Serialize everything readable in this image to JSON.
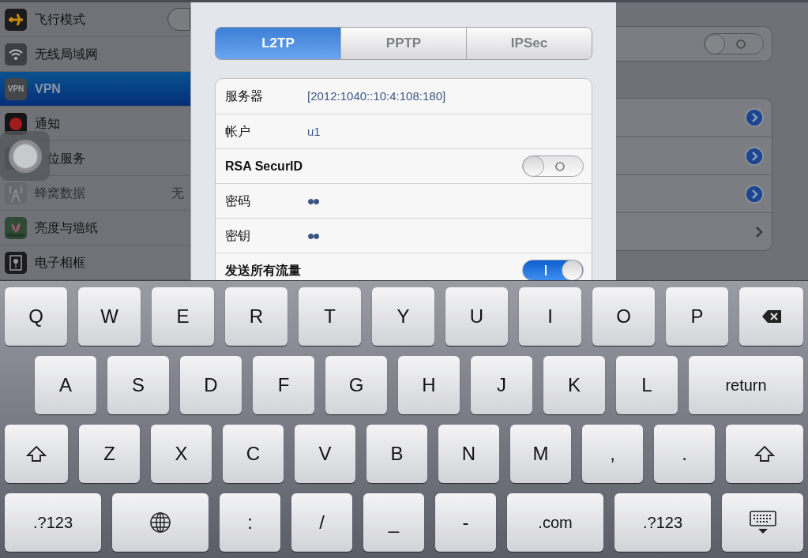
{
  "settings_list": [
    {
      "kind": "airplane",
      "label": "飞行模式",
      "selected": false,
      "disabled": false,
      "toggle_on": false
    },
    {
      "kind": "wifi",
      "label": "无线局域网",
      "selected": false,
      "disabled": false
    },
    {
      "kind": "vpn",
      "icon_text": "VPN",
      "label": "VPN",
      "selected": true,
      "disabled": false
    },
    {
      "kind": "notifications",
      "label": "通知",
      "selected": false,
      "disabled": false
    },
    {
      "kind": "location",
      "label": "位服务",
      "selected": false,
      "disabled": false
    },
    {
      "kind": "cellular",
      "label": "蜂窝数据",
      "value": "无",
      "selected": false,
      "disabled": true
    },
    {
      "kind": "wallpaper",
      "label": "亮度与墙纸",
      "selected": false,
      "disabled": false
    },
    {
      "kind": "frame",
      "label": "电子相框",
      "selected": false,
      "disabled": false
    }
  ],
  "background_panel": {
    "toggle_on": false,
    "rows": [
      {
        "kind": "detail"
      },
      {
        "kind": "detail"
      },
      {
        "kind": "detail"
      },
      {
        "kind": "chevron"
      }
    ]
  },
  "vpn_config": {
    "tabs": [
      {
        "label": "L2TP",
        "selected": true
      },
      {
        "label": "PPTP",
        "selected": false
      },
      {
        "label": "IPSec",
        "selected": false
      }
    ],
    "fields": [
      {
        "kind": "text",
        "label": "服务器",
        "value": "[2012:1040::10:4:108:180]"
      },
      {
        "kind": "text",
        "label": "帐户",
        "value": "u1"
      },
      {
        "kind": "switch",
        "label": "RSA SecurID",
        "on": false
      },
      {
        "kind": "secret",
        "label": "密码",
        "value": "••"
      },
      {
        "kind": "secret",
        "label": "密钥",
        "value": "••"
      },
      {
        "kind": "switch",
        "label": "发送所有流量",
        "on": true
      }
    ]
  },
  "keyboard": {
    "rows": [
      [
        {
          "kind": "char",
          "label": "Q"
        },
        {
          "kind": "char",
          "label": "W"
        },
        {
          "kind": "char",
          "label": "E"
        },
        {
          "kind": "char",
          "label": "R"
        },
        {
          "kind": "char",
          "label": "T"
        },
        {
          "kind": "char",
          "label": "Y"
        },
        {
          "kind": "char",
          "label": "U"
        },
        {
          "kind": "char",
          "label": "I"
        },
        {
          "kind": "char",
          "label": "O"
        },
        {
          "kind": "char",
          "label": "P"
        },
        {
          "kind": "backspace"
        }
      ],
      [
        {
          "kind": "char",
          "label": "A"
        },
        {
          "kind": "char",
          "label": "S"
        },
        {
          "kind": "char",
          "label": "D"
        },
        {
          "kind": "char",
          "label": "F"
        },
        {
          "kind": "char",
          "label": "G"
        },
        {
          "kind": "char",
          "label": "H"
        },
        {
          "kind": "char",
          "label": "J"
        },
        {
          "kind": "char",
          "label": "K"
        },
        {
          "kind": "char",
          "label": "L"
        },
        {
          "kind": "return",
          "label": "return"
        }
      ],
      [
        {
          "kind": "shift"
        },
        {
          "kind": "char",
          "label": "Z"
        },
        {
          "kind": "char",
          "label": "X"
        },
        {
          "kind": "char",
          "label": "C"
        },
        {
          "kind": "char",
          "label": "V"
        },
        {
          "kind": "char",
          "label": "B"
        },
        {
          "kind": "char",
          "label": "N"
        },
        {
          "kind": "char",
          "label": "M"
        },
        {
          "kind": "char",
          "label": ","
        },
        {
          "kind": "char",
          "label": "."
        },
        {
          "kind": "shift"
        }
      ],
      [
        {
          "kind": "wide",
          "label": ".?123"
        },
        {
          "kind": "globe"
        },
        {
          "kind": "char",
          "label": ":"
        },
        {
          "kind": "char",
          "label": "/"
        },
        {
          "kind": "char",
          "label": "_"
        },
        {
          "kind": "char",
          "label": "-"
        },
        {
          "kind": "wide",
          "label": ".com"
        },
        {
          "kind": "wide",
          "label": ".?123"
        },
        {
          "kind": "hide"
        }
      ]
    ]
  }
}
